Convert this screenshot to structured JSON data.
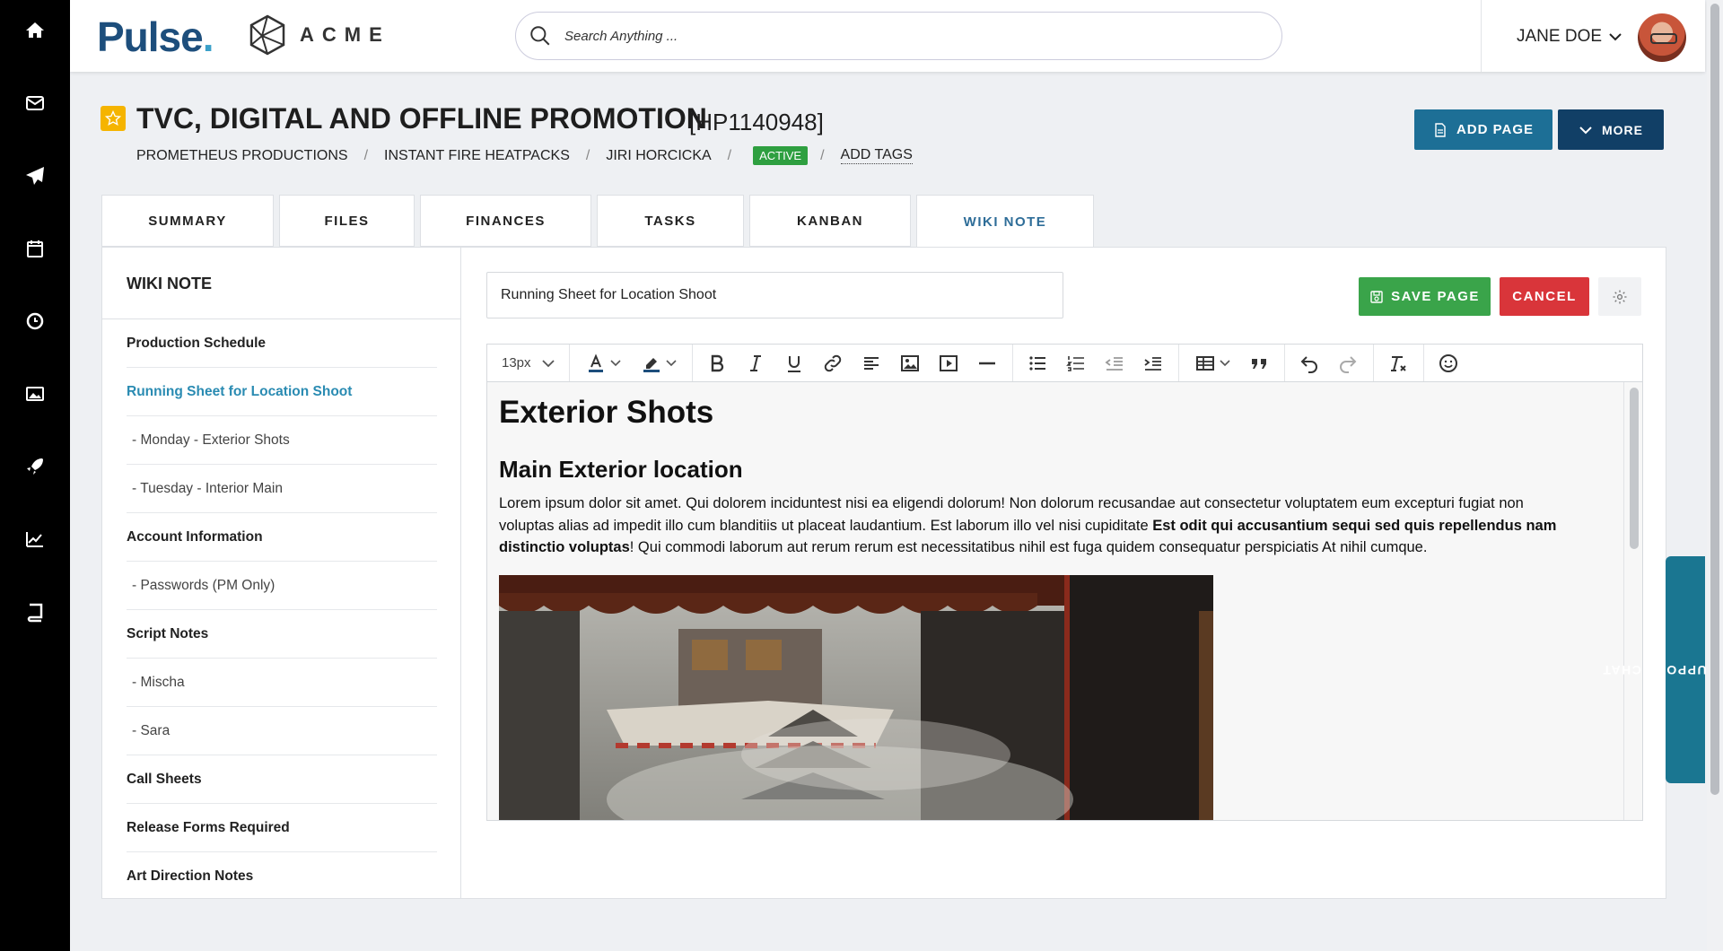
{
  "rail": {
    "items": [
      {
        "icon": "home-icon"
      },
      {
        "icon": "mail-icon"
      },
      {
        "icon": "send-icon"
      },
      {
        "icon": "calendar-icon"
      },
      {
        "icon": "clock-icon"
      },
      {
        "icon": "image-icon"
      },
      {
        "icon": "rocket-icon"
      },
      {
        "icon": "chart-icon"
      },
      {
        "icon": "book-icon"
      }
    ]
  },
  "header": {
    "brand": "Pulse",
    "partner_brand": "ACME",
    "search_placeholder": "Search Anything ...",
    "user_name": "JANE DOE"
  },
  "project": {
    "title": "TVC, DIGITAL AND OFFLINE PROMOTION",
    "code": "[HP1140948]",
    "breadcrumb": [
      "PROMETHEUS PRODUCTIONS",
      "INSTANT FIRE HEATPACKS",
      "JIRI HORCICKA"
    ],
    "status": "ACTIVE",
    "add_tags": "ADD TAGS",
    "add_page_label": "ADD PAGE",
    "more_label": "MORE"
  },
  "tabs": [
    "SUMMARY",
    "FILES",
    "FINANCES",
    "TASKS",
    "KANBAN",
    "WIKI NOTE"
  ],
  "active_tab": "WIKI NOTE",
  "wiki": {
    "sidebar_title": "WIKI NOTE",
    "items": [
      {
        "label": "Production Schedule",
        "level": "parent"
      },
      {
        "label": "Running Sheet for Location Shoot",
        "level": "current"
      },
      {
        "label": "- Monday - Exterior Shots",
        "level": "child"
      },
      {
        "label": "- Tuesday - Interior Main",
        "level": "child"
      },
      {
        "label": "Account Information",
        "level": "parent"
      },
      {
        "label": "- Passwords (PM Only)",
        "level": "child"
      },
      {
        "label": "Script Notes",
        "level": "parent"
      },
      {
        "label": "- Mischa",
        "level": "child"
      },
      {
        "label": "- Sara",
        "level": "child"
      },
      {
        "label": "Call Sheets",
        "level": "parent"
      },
      {
        "label": "Release Forms Required",
        "level": "parent"
      },
      {
        "label": "Art Direction Notes",
        "level": "parent"
      }
    ],
    "page_title_value": "Running Sheet for Location Shoot",
    "save_label": "SAVE PAGE",
    "cancel_label": "CANCEL",
    "font_size": "13px",
    "content": {
      "h1": "Exterior Shots",
      "h2": "Main Exterior location",
      "para_part1": "Lorem ipsum dolor sit amet. Qui dolorem inciduntest nisi ea eligendi dolorum! Non dolorum recusandae aut consectetur voluptatem eum excepturi fugiat non voluptas alias ad impedit illo cum blanditiis ut placeat laudantium. Est laborum illo vel nisi cupiditate ",
      "para_bold": "Est odit qui accusantium sequi sed quis repellendus nam distinctio voluptas",
      "para_part2": "! Qui commodi laborum aut rerum rerum est necessitatibus nihil est fuga quidem consequatur perspiciatis At nihil cumque."
    }
  },
  "support_chat_label": "PULSE SUPPORT CHAT",
  "colors": {
    "brand_navy": "#1d4e7c",
    "add_page": "#1d6f96",
    "more": "#113f66",
    "save": "#3aa44a",
    "cancel": "#d9353a",
    "active_badge": "#2e9f40",
    "link_active": "#2a8bb2",
    "chat": "#1a7691"
  }
}
